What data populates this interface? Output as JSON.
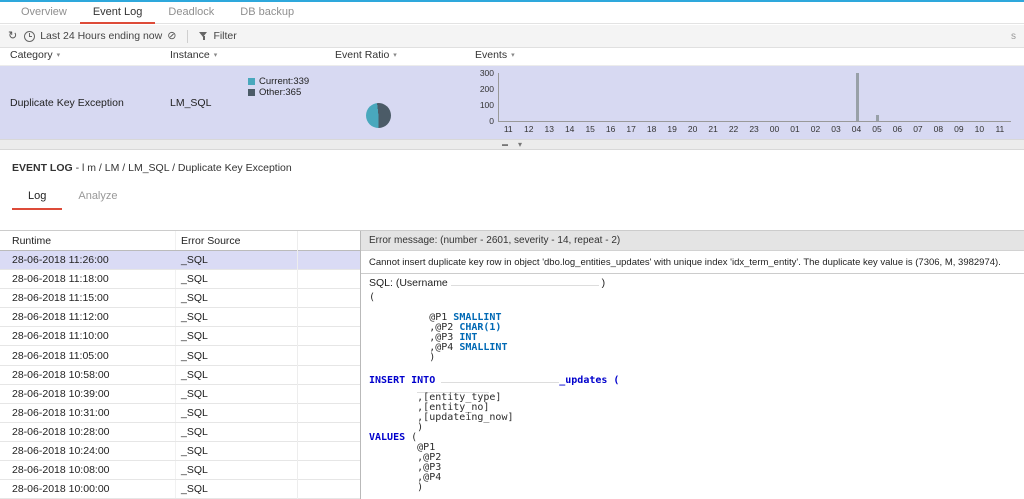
{
  "colors": {
    "accent_red": "#dd4b39",
    "row_highlight": "#d7d9f2",
    "selected_row": "#dadbf5",
    "pie_current": "#49a8bd",
    "pie_other": "#4b5b67",
    "bar": "#98a0a8",
    "top_line": "#2ea8dc"
  },
  "icons": {
    "refresh": "↻",
    "clock": "css-clock-shape",
    "time_end": "⊘",
    "filter": "css-funnel-shape",
    "caret": "▾",
    "splitter_bar": "▬",
    "splitter_chevron": "▾"
  },
  "top_tabs": [
    {
      "label": "Overview",
      "active": false
    },
    {
      "label": "Event Log",
      "active": true
    },
    {
      "label": "Deadlock",
      "active": false
    },
    {
      "label": "DB backup",
      "active": false
    }
  ],
  "toolbar": {
    "time_range": "Last 24 Hours ending now",
    "filter_label": "Filter",
    "right_partial": "s"
  },
  "event_table": {
    "columns": [
      "Category",
      "Instance",
      "Event Ratio",
      "Events"
    ],
    "row": {
      "category": "Duplicate Key Exception",
      "instance": "LM_SQL",
      "legend": [
        {
          "label": "Current:339",
          "value": 339,
          "color": "#49a8bd"
        },
        {
          "label": "Other:365",
          "value": 365,
          "color": "#4b5b67"
        }
      ]
    }
  },
  "chart_data": {
    "type": "bar",
    "title": "",
    "xlabel": "",
    "ylabel": "",
    "categories": [
      "11",
      "12",
      "13",
      "14",
      "15",
      "16",
      "17",
      "18",
      "19",
      "20",
      "21",
      "22",
      "23",
      "00",
      "01",
      "02",
      "03",
      "04",
      "05",
      "06",
      "07",
      "08",
      "09",
      "10",
      "11"
    ],
    "values": [
      0,
      0,
      0,
      0,
      0,
      0,
      0,
      0,
      0,
      0,
      0,
      0,
      0,
      0,
      0,
      0,
      0,
      339,
      40,
      0,
      0,
      0,
      0,
      0,
      0
    ],
    "ylim": [
      0,
      300
    ],
    "yticks": [
      300,
      200,
      100,
      0
    ],
    "grid": false,
    "legend_position": "none"
  },
  "detail": {
    "title": "EVENT LOG",
    "path": " - l m / LM / LM_SQL / Duplicate Key Exception",
    "tabs": [
      {
        "label": "Log",
        "active": true
      },
      {
        "label": "Analyze",
        "active": false
      }
    ],
    "log_table": {
      "columns": [
        "Runtime",
        "Error Source"
      ],
      "selected_index": 0,
      "rows": [
        [
          "28-06-2018 11:26:00",
          "_SQL"
        ],
        [
          "28-06-2018 11:18:00",
          "_SQL"
        ],
        [
          "28-06-2018 11:15:00",
          "_SQL"
        ],
        [
          "28-06-2018 11:12:00",
          "_SQL"
        ],
        [
          "28-06-2018 11:10:00",
          "_SQL"
        ],
        [
          "28-06-2018 11:05:00",
          "_SQL"
        ],
        [
          "28-06-2018 10:58:00",
          "_SQL"
        ],
        [
          "28-06-2018 10:39:00",
          "_SQL"
        ],
        [
          "28-06-2018 10:31:00",
          "_SQL"
        ],
        [
          "28-06-2018 10:28:00",
          "_SQL"
        ],
        [
          "28-06-2018 10:24:00",
          "_SQL"
        ],
        [
          "28-06-2018 10:08:00",
          "_SQL"
        ],
        [
          "28-06-2018 10:00:00",
          "_SQL"
        ]
      ]
    },
    "error_panel": {
      "header": "Error message: (number - 2601, severity - 14, repeat - 2)",
      "message": "Cannot insert duplicate key row in object 'dbo.log_entities_updates' with unique index 'idx_term_entity'. The duplicate key value is (7306, M, 3982974).",
      "sql_label": "SQL: (Username",
      "sql_label_close": ")",
      "sql_lines": [
        [
          {
            "t": "("
          }
        ],
        [],
        [
          {
            "t": "          @P1 "
          },
          {
            "t": "SMALLINT",
            "c": "type"
          }
        ],
        [
          {
            "t": "          ,@P2 "
          },
          {
            "t": "CHAR(1)",
            "c": "type"
          }
        ],
        [
          {
            "t": "          ,@P3 "
          },
          {
            "t": "INT",
            "c": "type"
          }
        ],
        [
          {
            "t": "          ,@P4 "
          },
          {
            "t": "SMALLINT",
            "c": "type"
          }
        ],
        [
          {
            "t": "          )"
          }
        ],
        [],
        [
          {
            "t": "INSERT INTO ",
            "c": "kw"
          },
          {
            "r": 118
          },
          {
            "t": "_updates (",
            "c": "kw"
          }
        ],
        [
          {
            "t": "        "
          },
          {
            "r": 72
          }
        ],
        [
          {
            "t": "        ,[entity_type]"
          }
        ],
        [
          {
            "t": "        ,[entity_no]"
          }
        ],
        [
          {
            "t": "        ,[updateing_now]"
          }
        ],
        [
          {
            "t": "        )"
          }
        ],
        [
          {
            "t": "VALUES",
            "c": "kw"
          },
          {
            "t": " ("
          }
        ],
        [
          {
            "t": "        @P1"
          }
        ],
        [
          {
            "t": "        ,@P2"
          }
        ],
        [
          {
            "t": "        ,@P3"
          }
        ],
        [
          {
            "t": "        ,@P4"
          }
        ],
        [
          {
            "t": "        )"
          }
        ]
      ]
    }
  }
}
